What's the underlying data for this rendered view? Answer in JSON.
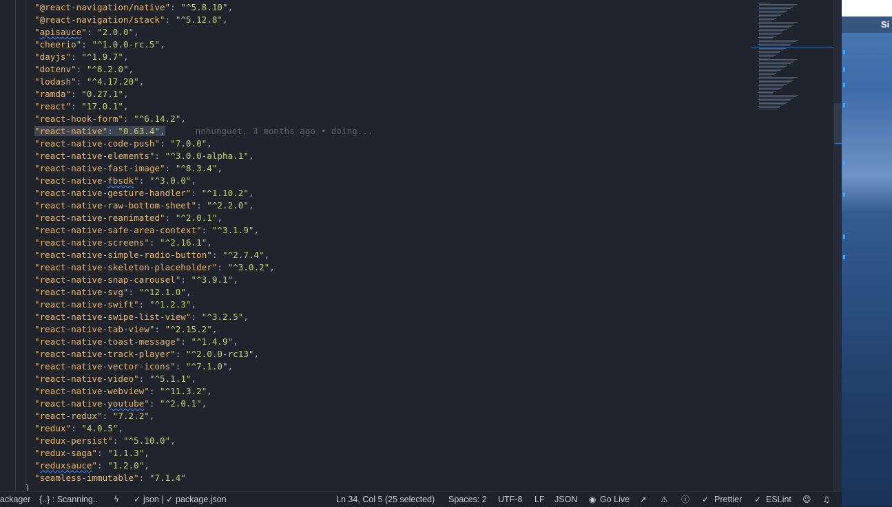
{
  "editor": {
    "lines": [
      {
        "key": "@react-navigation/native",
        "value": "^5.8.10"
      },
      {
        "key": "@react-navigation/stack",
        "value": "^5.12.8"
      },
      {
        "key": "apisauce",
        "value": "2.0.0",
        "squiggle": "apisauce"
      },
      {
        "key": "cheerio",
        "value": "^1.0.0-rc.5"
      },
      {
        "key": "dayjs",
        "value": "^1.9.7"
      },
      {
        "key": "dotenv",
        "value": "^8.2.0"
      },
      {
        "key": "lodash",
        "value": "^4.17.20"
      },
      {
        "key": "ramda",
        "value": "0.27.1"
      },
      {
        "key": "react",
        "value": "17.0.1"
      },
      {
        "key": "react-hook-form",
        "value": "^6.14.2"
      },
      {
        "key": "react-native",
        "value": "0.63.4",
        "selected": true,
        "blame": "nnhunguet, 3 months ago • doing..."
      },
      {
        "key": "react-native-code-push",
        "value": "7.0.0"
      },
      {
        "key": "react-native-elements",
        "value": "^3.0.0-alpha.1"
      },
      {
        "key": "react-native-fast-image",
        "value": "^8.3.4"
      },
      {
        "key": "react-native-fbsdk",
        "value": "^3.0.0",
        "squiggle": "fbsdk"
      },
      {
        "key": "react-native-gesture-handler",
        "value": "^1.10.2"
      },
      {
        "key": "react-native-raw-bottom-sheet",
        "value": "^2.2.0"
      },
      {
        "key": "react-native-reanimated",
        "value": "^2.0.1"
      },
      {
        "key": "react-native-safe-area-context",
        "value": "^3.1.9"
      },
      {
        "key": "react-native-screens",
        "value": "^2.16.1"
      },
      {
        "key": "react-native-simple-radio-button",
        "value": "^2.7.4"
      },
      {
        "key": "react-native-skeleton-placeholder",
        "value": "^3.0.2"
      },
      {
        "key": "react-native-snap-carousel",
        "value": "^3.9.1"
      },
      {
        "key": "react-native-svg",
        "value": "^12.1.0"
      },
      {
        "key": "react-native-swift",
        "value": "^1.2.3"
      },
      {
        "key": "react-native-swipe-list-view",
        "value": "^3.2.5"
      },
      {
        "key": "react-native-tab-view",
        "value": "^2.15.2"
      },
      {
        "key": "react-native-toast-message",
        "value": "^1.4.9"
      },
      {
        "key": "react-native-track-player",
        "value": "^2.0.0-rc13"
      },
      {
        "key": "react-native-vector-icons",
        "value": "^7.1.0"
      },
      {
        "key": "react-native-video",
        "value": "^5.1.1"
      },
      {
        "key": "react-native-webview",
        "value": "^11.3.2"
      },
      {
        "key": "react-native-youtube",
        "value": "^2.0.1",
        "squiggle": "youtube"
      },
      {
        "key": "react-redux",
        "value": "7.2.2"
      },
      {
        "key": "redux",
        "value": "4.0.5"
      },
      {
        "key": "redux-persist",
        "value": "^5.10.0"
      },
      {
        "key": "redux-saga",
        "value": "1.1.3"
      },
      {
        "key": "reduxsauce",
        "value": "1.2.0",
        "squiggle": "reduxsauce"
      },
      {
        "key": "seamless-immutable",
        "value": "7.1.4",
        "last": true
      }
    ],
    "closing_brace": "}"
  },
  "desktop": {
    "menu_text": "Si",
    "apple_icon": "apple-logo-icon"
  },
  "statusbar": {
    "packager": "ackager",
    "scanning": "{..} : Scanning..",
    "json_check": "✓ json | ✓ package.json",
    "cursor_position": "Ln 34, Col 5 (25 selected)",
    "indentation": "Spaces: 2",
    "encoding": "UTF-8",
    "line_ending": "LF",
    "language": "JSON",
    "go_live": "Go Live",
    "prettier": "Prettier",
    "eslint": "ESLint",
    "icons": [
      "lightning-icon",
      "broadcast-icon",
      "rocket-icon",
      "warning-icon",
      "info-icon",
      "check-double-icon",
      "feedback-icon",
      "bell-icon"
    ]
  }
}
